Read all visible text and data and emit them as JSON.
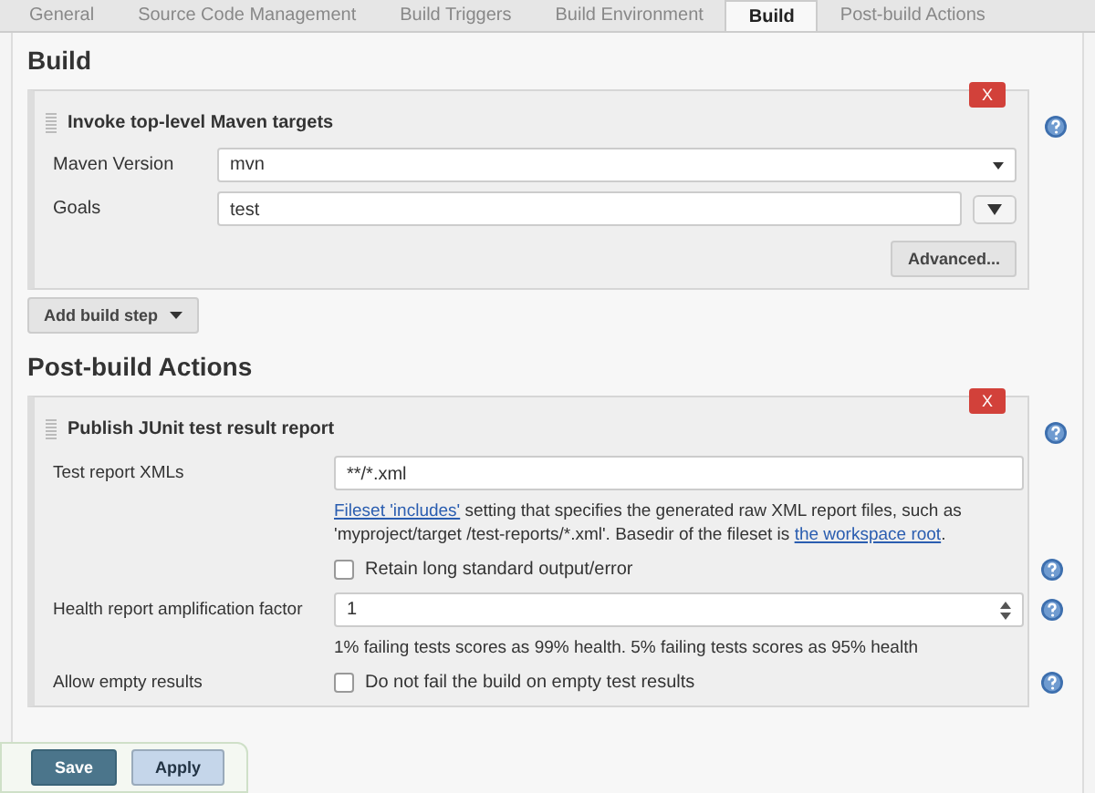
{
  "tabs": [
    {
      "label": "General",
      "selected": false
    },
    {
      "label": "Source Code Management",
      "selected": false
    },
    {
      "label": "Build Triggers",
      "selected": false
    },
    {
      "label": "Build Environment",
      "selected": false
    },
    {
      "label": "Build",
      "selected": true
    },
    {
      "label": "Post-build Actions",
      "selected": false
    }
  ],
  "build": {
    "heading": "Build",
    "steps": [
      {
        "title": "Invoke top-level Maven targets",
        "delete": "X",
        "help": true,
        "fields": [
          {
            "kind": "select",
            "label": "Maven Version",
            "value": "mvn"
          },
          {
            "kind": "expandable",
            "label": "Goals",
            "value": "test"
          }
        ],
        "advanced": "Advanced..."
      }
    ],
    "add_button": "Add build step"
  },
  "post_build": {
    "heading": "Post-build Actions",
    "actions": [
      {
        "title": "Publish JUnit test result report",
        "delete": "X",
        "help": true,
        "rows": [
          {
            "kind": "text",
            "label": "Test report XMLs",
            "value": "**/*.xml",
            "help": false,
            "description": [
              {
                "text": "Fileset 'includes'",
                "link": true
              },
              {
                "text": " setting that specifies the generated raw XML report files, such as 'myproject/target /test-reports/*.xml'. Basedir of the fileset is ",
                "link": false
              },
              {
                "text": "the workspace root",
                "link": true
              },
              {
                "text": ".",
                "link": false
              }
            ]
          },
          {
            "kind": "checkbox",
            "text": "Retain long standard output/error",
            "checked": false,
            "help": true
          },
          {
            "kind": "number",
            "label": "Health report amplification factor",
            "value": "1",
            "help": true,
            "hint": "1% failing tests scores as 99% health. 5% failing tests scores as 95% health"
          },
          {
            "kind": "checkbox",
            "label": "Allow empty results",
            "text": "Do not fail the build on empty test results",
            "checked": false,
            "help": true
          }
        ]
      }
    ]
  },
  "footer": {
    "buttons": [
      {
        "label": "Save",
        "kind": "primary"
      },
      {
        "label": "Apply",
        "kind": "secondary"
      }
    ]
  }
}
